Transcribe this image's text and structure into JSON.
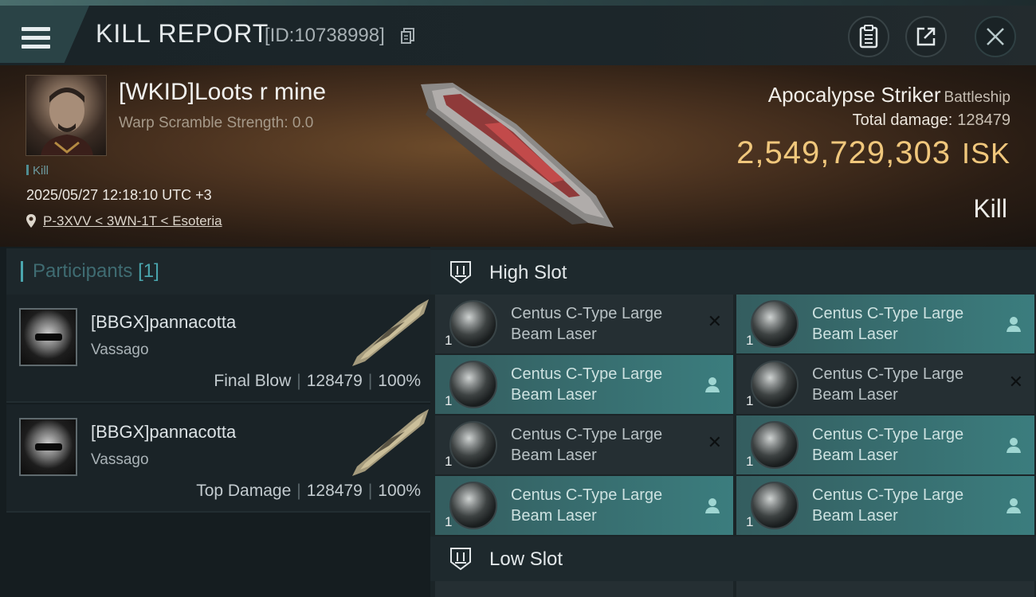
{
  "header": {
    "title": "KILL REPORT",
    "report_id": "[ID:10738998]"
  },
  "victim": {
    "name": "[WKID]Loots r mine",
    "warp_scramble": "Warp Scramble Strength: 0.0",
    "tag": "Kill",
    "timestamp": "2025/05/27 12:18:10 UTC +3",
    "location": "P-3XVV < 3WN-1T < Esoteria",
    "ship_name": "Apocalypse Striker",
    "ship_class": "Battleship",
    "total_damage_label": "Total damage:",
    "total_damage": "128479",
    "isk_value": "2,549,729,303",
    "isk_unit": "ISK",
    "result": "Kill"
  },
  "participants": {
    "label": "Participants",
    "count": "[1]",
    "rows": [
      {
        "name": "[BBGX]pannacotta",
        "ship": "Vassago",
        "role": "Final Blow",
        "damage": "128479",
        "percent": "100%"
      },
      {
        "name": "[BBGX]pannacotta",
        "ship": "Vassago",
        "role": "Top Damage",
        "damage": "128479",
        "percent": "100%"
      }
    ]
  },
  "slots": {
    "high_label": "High Slot",
    "low_label": "Low Slot",
    "high_items": [
      {
        "line1": "Centus C-Type Large",
        "line2": "Beam Laser",
        "qty": "1",
        "status": "destroyed"
      },
      {
        "line1": "Centus C-Type Large",
        "line2": "Beam Laser",
        "qty": "1",
        "status": "dropped"
      },
      {
        "line1": "Centus C-Type Large",
        "line2": "Beam Laser",
        "qty": "1",
        "status": "dropped"
      },
      {
        "line1": "Centus C-Type Large",
        "line2": "Beam Laser",
        "qty": "1",
        "status": "destroyed"
      },
      {
        "line1": "Centus C-Type Large",
        "line2": "Beam Laser",
        "qty": "1",
        "status": "destroyed"
      },
      {
        "line1": "Centus C-Type Large",
        "line2": "Beam Laser",
        "qty": "1",
        "status": "dropped"
      },
      {
        "line1": "Centus C-Type Large",
        "line2": "Beam Laser",
        "qty": "1",
        "status": "dropped"
      },
      {
        "line1": "Centus C-Type Large",
        "line2": "Beam Laser",
        "qty": "1",
        "status": "dropped"
      }
    ]
  },
  "colors": {
    "accent": "#4aa6ae",
    "isk_gold": "#f0c77c",
    "dropped_highlight": "#3b7d7e"
  },
  "icons": {
    "menu": "hamburger-menu-icon",
    "copy": "copy-icon",
    "clipboard": "clipboard-icon",
    "share": "share-icon",
    "close": "close-icon",
    "location": "location-pin-icon",
    "slot": "high-slot-icon",
    "dropped": "person-icon",
    "destroyed": "x-icon"
  }
}
